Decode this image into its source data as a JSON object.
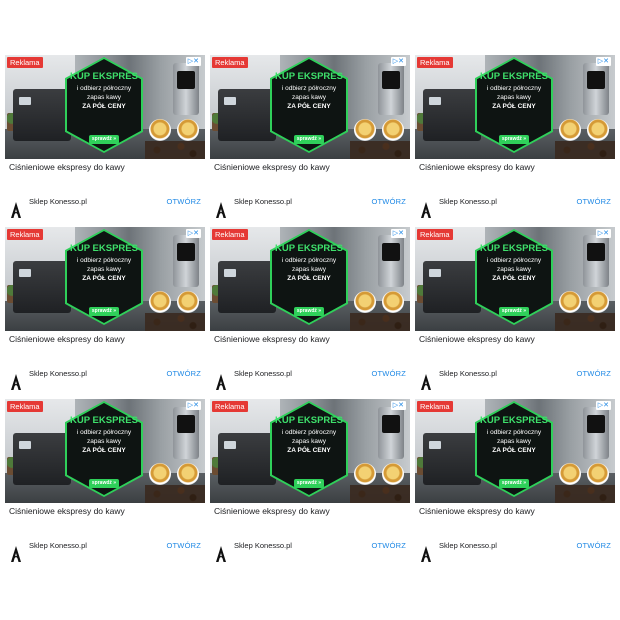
{
  "ad": {
    "badge": "Reklama",
    "adchoices": "▷✕",
    "headline": "KUP EKSPRES",
    "sub_line1": "i odbierz półroczny",
    "sub_line2": "zapas kawy",
    "sub_line3": "ZA PÓŁ CENY",
    "cta": "sprawdź »",
    "title": "Ciśnieniowe ekspresy do kawy",
    "shop": "Sklep Konesso.pl",
    "open_label": "OTWÓRZ"
  },
  "grid": {
    "rows": 3,
    "cols": 3
  },
  "colors": {
    "accent": "#2fd05a",
    "badge": "#e53935",
    "link": "#1e88e5"
  }
}
